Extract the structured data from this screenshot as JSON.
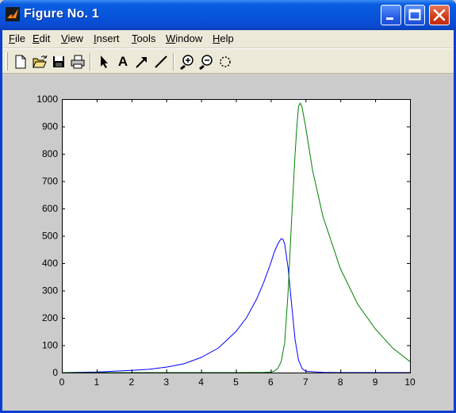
{
  "window": {
    "title": "Figure No. 1"
  },
  "menu": {
    "items": [
      {
        "label": "File",
        "ul": "F",
        "rest": "ile"
      },
      {
        "label": "Edit",
        "ul": "E",
        "rest": "dit"
      },
      {
        "label": "View",
        "ul": "V",
        "rest": "iew"
      },
      {
        "label": "Insert",
        "ul": "I",
        "rest": "nsert"
      },
      {
        "label": "Tools",
        "ul": "T",
        "rest": "ools"
      },
      {
        "label": "Window",
        "ul": "W",
        "rest": "indow"
      },
      {
        "label": "Help",
        "ul": "H",
        "rest": "elp"
      }
    ]
  },
  "toolbar": {
    "buttons": [
      "new-file-icon",
      "open-folder-icon",
      "save-icon",
      "print-icon",
      "select-arrow-icon",
      "insert-text-icon",
      "insert-arrow-icon",
      "insert-line-icon",
      "zoom-in-icon",
      "zoom-out-icon",
      "rotate-3d-icon"
    ],
    "text_tool_label": "A"
  },
  "colors": {
    "series_blue": "#0000ff",
    "series_green": "#008000",
    "figure_bg": "#cbcbcb",
    "axes_bg": "#ffffff"
  },
  "chart_data": {
    "type": "line",
    "title": "",
    "xlabel": "",
    "ylabel": "",
    "xlim": [
      0,
      10
    ],
    "ylim": [
      0,
      1000
    ],
    "xticks": [
      0,
      1,
      2,
      3,
      4,
      5,
      6,
      7,
      8,
      9,
      10
    ],
    "yticks": [
      0,
      100,
      200,
      300,
      400,
      500,
      600,
      700,
      800,
      900,
      1000
    ],
    "grid": false,
    "series": [
      {
        "color": "#0000ff",
        "x": [
          0,
          1,
          1.5,
          2,
          2.5,
          3,
          3.5,
          4,
          4.5,
          5,
          5.3,
          5.6,
          5.8,
          6.0,
          6.1,
          6.2,
          6.3,
          6.35,
          6.4,
          6.5,
          6.6,
          6.7,
          6.8,
          6.9,
          7.0,
          7.5,
          8,
          10
        ],
        "y": [
          0,
          2,
          5,
          8,
          12,
          20,
          32,
          55,
          90,
          150,
          200,
          270,
          330,
          400,
          440,
          470,
          490,
          487,
          470,
          380,
          250,
          120,
          45,
          15,
          5,
          1,
          0,
          0
        ]
      },
      {
        "color": "#008000",
        "x": [
          0,
          5,
          5.8,
          6.0,
          6.1,
          6.2,
          6.3,
          6.4,
          6.5,
          6.6,
          6.7,
          6.75,
          6.8,
          6.85,
          6.9,
          7.0,
          7.2,
          7.5,
          8,
          8.5,
          9,
          9.5,
          10
        ],
        "y": [
          0,
          0,
          1,
          2,
          5,
          15,
          40,
          110,
          300,
          560,
          800,
          900,
          975,
          985,
          970,
          900,
          740,
          570,
          380,
          250,
          160,
          90,
          40
        ]
      }
    ]
  }
}
